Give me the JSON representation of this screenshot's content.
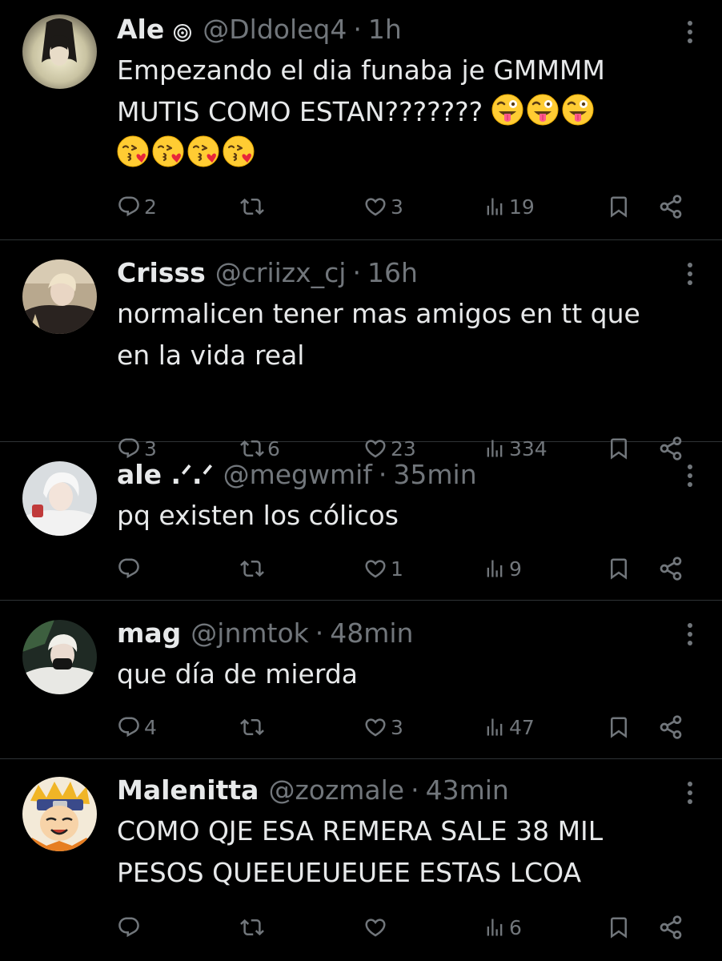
{
  "tweets": [
    {
      "name": "Ale",
      "badge_icon": "spiral-icon",
      "handle": "@Dldoleq4",
      "separator": "·",
      "time": "1h",
      "text_lines": [
        "Empezando el dia funaba je GMMMM",
        "MUTIS COMO ESTAN???????"
      ],
      "emoji_line1": [
        "zany-face",
        "zany-face",
        "zany-face"
      ],
      "emoji_line2": [
        "face-blowing-kiss",
        "face-blowing-kiss",
        "face-blowing-kiss",
        "face-blowing-kiss"
      ],
      "replies": "2",
      "reposts": "",
      "likes": "3",
      "views": "19"
    },
    {
      "name": "Crisss",
      "handle": "@criizx_cj",
      "separator": "·",
      "time": "16h",
      "text_lines": [
        "normalicen tener mas amigos en tt que",
        "en la vida real"
      ],
      "replies": "3",
      "reposts": "6",
      "likes": "23",
      "views": "334"
    },
    {
      "name": "ale .ᐟ.ᐟ",
      "handle": "@megwmif",
      "separator": "·",
      "time": "35min",
      "text_lines": [
        "pq existen los cólicos"
      ],
      "replies": "",
      "reposts": "",
      "likes": "1",
      "views": "9"
    },
    {
      "name": "mag",
      "handle": "@jnmtok",
      "separator": "·",
      "time": "48min",
      "text_lines": [
        "que día de mierda"
      ],
      "replies": "4",
      "reposts": "",
      "likes": "3",
      "views": "47"
    },
    {
      "name": "Malenitta",
      "handle": "@zozmale",
      "separator": "·",
      "time": "43min",
      "text_lines": [
        "COMO QJE ESA REMERA SALE 38 MIL",
        "PESOS QUEEUEUEUEE ESTAS LCOA"
      ],
      "replies": "",
      "reposts": "",
      "likes": "",
      "views": "6"
    }
  ],
  "colors": {
    "background": "#000000",
    "text": "#e7e9ea",
    "secondary": "#71767b",
    "divider": "#2f3336"
  }
}
